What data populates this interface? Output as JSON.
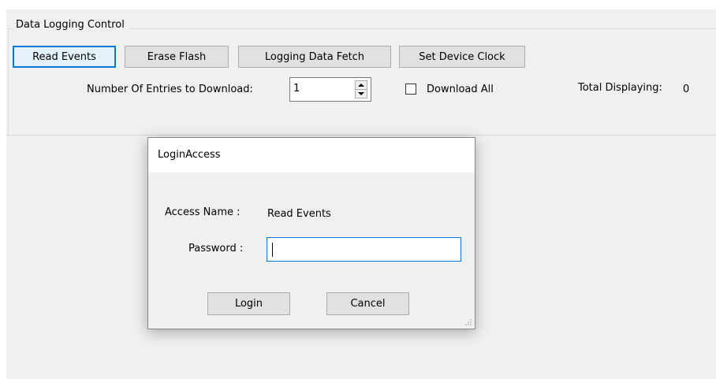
{
  "group": {
    "title": "Data Logging Control"
  },
  "toolbar": {
    "read_events": "Read Events",
    "erase_flash": "Erase Flash",
    "logging_data_fetch": "Logging Data Fetch",
    "set_device_clock": "Set Device Clock"
  },
  "entries": {
    "label": "Number Of Entries to Download:",
    "value": "1"
  },
  "download_all": {
    "label": "Download All",
    "checked": false
  },
  "total": {
    "label": "Total Displaying:",
    "value": "0"
  },
  "dialog": {
    "title": "LoginAccess",
    "access_name_label": "Access Name :",
    "access_name_value": "Read Events",
    "password_label": "Password :",
    "password_value": "",
    "login_label": "Login",
    "cancel_label": "Cancel"
  },
  "colors": {
    "focus_blue": "#0078d7",
    "panel_bg": "#f0f0f0",
    "button_bg": "#e1e1e1"
  }
}
